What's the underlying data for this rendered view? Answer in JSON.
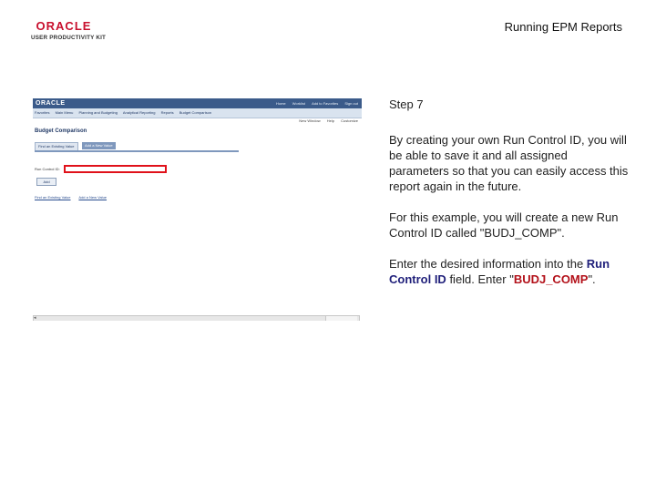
{
  "header": {
    "logo_brand": "ORACLE",
    "logo_tagline": "USER PRODUCTIVITY KIT",
    "page_title": "Running EPM Reports"
  },
  "thumbnail": {
    "app_logo": "ORACLE",
    "top_links": [
      "Home",
      "Worklist",
      "Add to Favorites",
      "Sign out"
    ],
    "menu_items": [
      "Favorites",
      "Main Menu",
      "Planning and Budgeting",
      "Analytical Reporting",
      "Reports",
      "Budget Comparison"
    ],
    "tools": [
      "New Window",
      "Help",
      "Customize"
    ],
    "page_heading": "Budget Comparison",
    "tabs": [
      "Find an Existing Value",
      "Add a New Value"
    ],
    "run_control_label": "Run Control ID:",
    "run_control_value": "",
    "add_button": "Add",
    "bottom_links": [
      "Find an Existing Value",
      "Add a New Value"
    ]
  },
  "instructions": {
    "step": "Step 7",
    "para1": "By creating your own Run Control ID, you will be able to save it and all assigned parameters so that you can easily access this report again in the future.",
    "para2": "For this example, you will create a new Run Control ID called \"BUDJ_COMP\".",
    "line3a": "Enter the desired information into the ",
    "field_name": "Run Control ID",
    "line3b": " field. Enter \"",
    "entry_value": "BUDJ_COMP",
    "line3c": "\"."
  }
}
